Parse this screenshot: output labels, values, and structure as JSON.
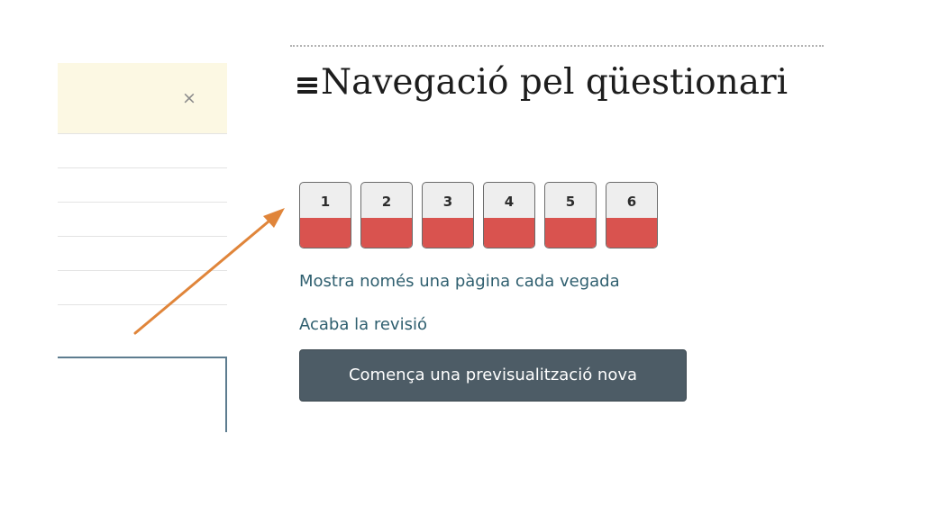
{
  "left_panel": {
    "close_label": "×"
  },
  "quiz_navigation": {
    "title": "Navegació pel qüestionari",
    "title_icon": "hamburger-icon",
    "questions": [
      {
        "number": "1",
        "state": "incorrect"
      },
      {
        "number": "2",
        "state": "incorrect"
      },
      {
        "number": "3",
        "state": "incorrect"
      },
      {
        "number": "4",
        "state": "incorrect"
      },
      {
        "number": "5",
        "state": "incorrect"
      },
      {
        "number": "6",
        "state": "incorrect"
      }
    ],
    "show_one_page_link": "Mostra només una pàgina cada vegada",
    "finish_review_link": "Acaba la revisió",
    "new_preview_button": "Comença una previsualització nova"
  },
  "colors": {
    "incorrect_state": "#d9534f",
    "button_primary": "#4d5c66",
    "link": "#2f5f6f",
    "arrow": "#e0853a",
    "alert_background": "#fcf8e3"
  }
}
